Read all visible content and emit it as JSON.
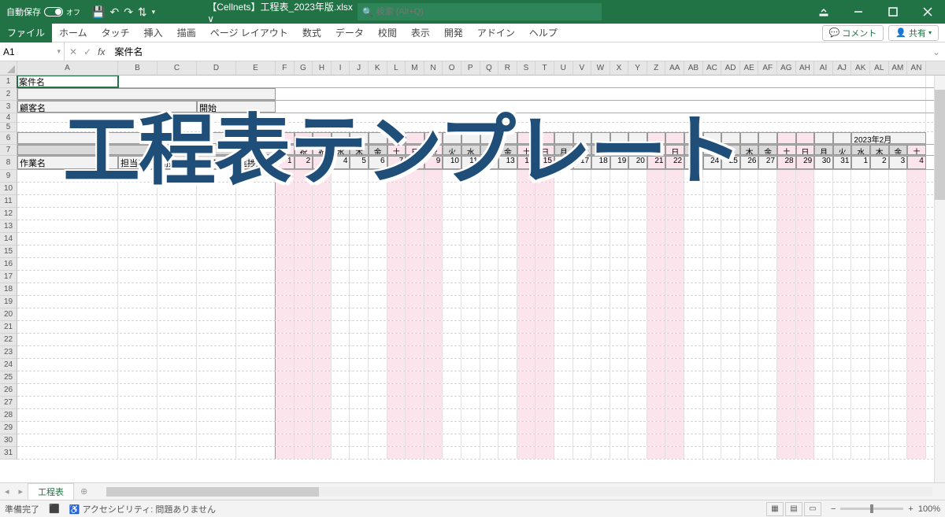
{
  "titlebar": {
    "autosave_label": "自動保存",
    "autosave_state": "オフ",
    "title": "【Cellnets】工程表_2023年版.xlsx ∨",
    "search_placeholder": "検索 (Alt+Q)"
  },
  "ribbon": {
    "tabs": [
      "ファイル",
      "ホーム",
      "タッチ",
      "挿入",
      "描画",
      "ページ レイアウト",
      "数式",
      "データ",
      "校閲",
      "表示",
      "開発",
      "アドイン",
      "ヘルプ"
    ],
    "comment_btn": "コメント",
    "share_btn": "共有"
  },
  "formula_bar": {
    "name_box": "A1",
    "fx_value": "案件名"
  },
  "columns": {
    "wide": [
      "A",
      "B",
      "C",
      "D",
      "E"
    ],
    "narrow": [
      "F",
      "G",
      "H",
      "I",
      "J",
      "K",
      "L",
      "M",
      "N",
      "O",
      "P",
      "Q",
      "R",
      "S",
      "T",
      "U",
      "V",
      "W",
      "X",
      "Y",
      "Z",
      "AA",
      "AB",
      "AC",
      "AD",
      "AE",
      "AF",
      "AG",
      "AH",
      "AI",
      "AJ",
      "AK",
      "AL",
      "AM",
      "AN"
    ]
  },
  "row_heights": {
    "header_rows": [
      16,
      16,
      16,
      12,
      12,
      16,
      14,
      18
    ],
    "data_row": 16
  },
  "sheet": {
    "a1": "案件名",
    "a3": "顧客名",
    "e3": "開始",
    "month2": "2023年2月",
    "row7_days": [
      "日",
      "祝",
      "祝",
      "水",
      "木",
      "金",
      "土",
      "日",
      "祝",
      "火",
      "水",
      "木",
      "金",
      "土",
      "日",
      "月",
      "火",
      "水",
      "木",
      "金",
      "土",
      "日",
      "月",
      "火",
      "水",
      "木",
      "金",
      "土",
      "日",
      "月",
      "火",
      "水",
      "木",
      "金",
      "土"
    ],
    "row8_labels": [
      "作業名",
      "担当者",
      "開始日",
      "終了日",
      "進捗度"
    ],
    "row8_dates": [
      1,
      2,
      3,
      4,
      5,
      6,
      7,
      8,
      9,
      10,
      11,
      12,
      13,
      14,
      15,
      16,
      17,
      18,
      19,
      20,
      21,
      22,
      23,
      24,
      25,
      26,
      27,
      28,
      29,
      30,
      31,
      1,
      2,
      3,
      4
    ],
    "pink_cols": [
      0,
      1,
      2,
      6,
      7,
      8,
      13,
      14,
      20,
      21,
      27,
      28,
      34
    ],
    "row_numbers": [
      1,
      2,
      3,
      4,
      5,
      6,
      7,
      8,
      9,
      10,
      11,
      12,
      13,
      14,
      15,
      16,
      17,
      18,
      19,
      20,
      21,
      22,
      23,
      24,
      25,
      26,
      27,
      28,
      29,
      30,
      31
    ]
  },
  "sheet_tab": "工程表",
  "statusbar": {
    "ready": "準備完了",
    "accessibility": "アクセシビリティ: 問題ありません",
    "zoom": "100%"
  },
  "overlay_title": "工程表テンプレート"
}
